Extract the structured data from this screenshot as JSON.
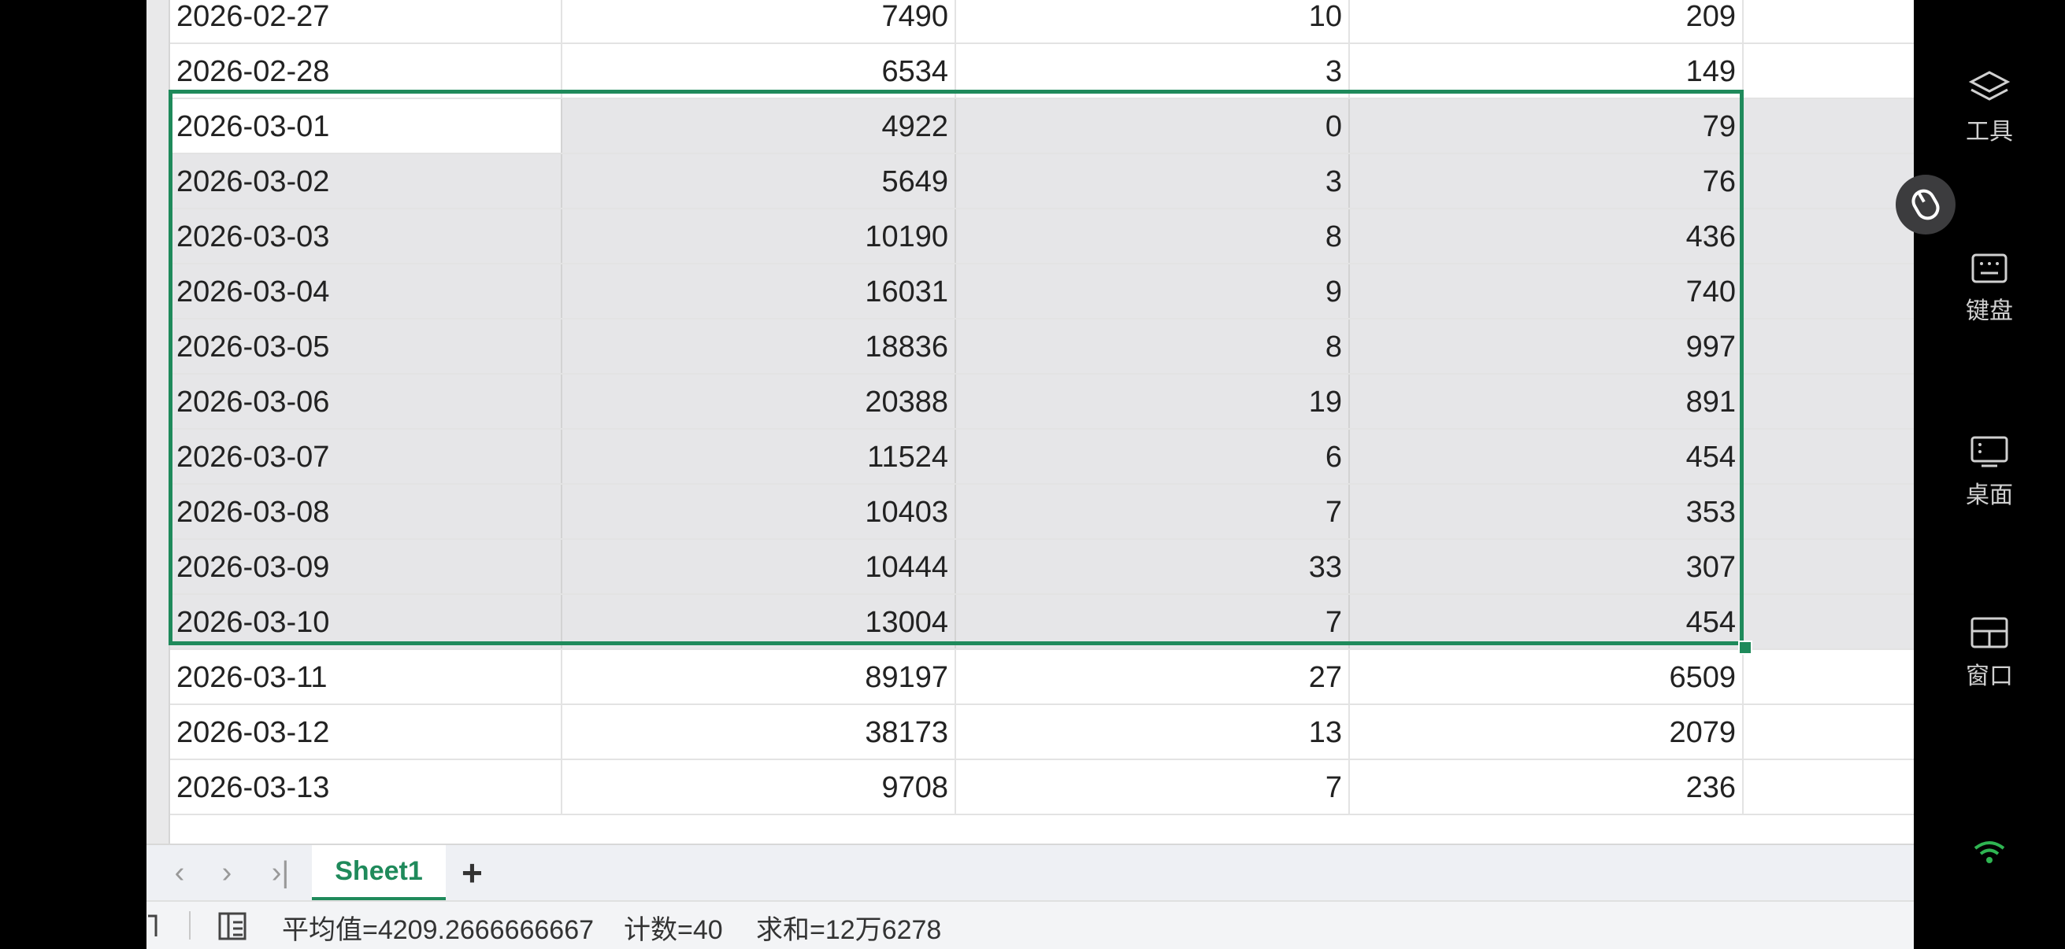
{
  "rows": [
    {
      "date": "2026-02-27",
      "a": "7490",
      "b": "10",
      "c": "209"
    },
    {
      "date": "2026-02-28",
      "a": "6534",
      "b": "3",
      "c": "149"
    },
    {
      "date": "2026-03-01",
      "a": "4922",
      "b": "0",
      "c": "79"
    },
    {
      "date": "2026-03-02",
      "a": "5649",
      "b": "3",
      "c": "76"
    },
    {
      "date": "2026-03-03",
      "a": "10190",
      "b": "8",
      "c": "436"
    },
    {
      "date": "2026-03-04",
      "a": "16031",
      "b": "9",
      "c": "740"
    },
    {
      "date": "2026-03-05",
      "a": "18836",
      "b": "8",
      "c": "997"
    },
    {
      "date": "2026-03-06",
      "a": "20388",
      "b": "19",
      "c": "891"
    },
    {
      "date": "2026-03-07",
      "a": "11524",
      "b": "6",
      "c": "454"
    },
    {
      "date": "2026-03-08",
      "a": "10403",
      "b": "7",
      "c": "353"
    },
    {
      "date": "2026-03-09",
      "a": "10444",
      "b": "33",
      "c": "307"
    },
    {
      "date": "2026-03-10",
      "a": "13004",
      "b": "7",
      "c": "454"
    },
    {
      "date": "2026-03-11",
      "a": "89197",
      "b": "27",
      "c": "6509"
    },
    {
      "date": "2026-03-12",
      "a": "38173",
      "b": "13",
      "c": "2079"
    },
    {
      "date": "2026-03-13",
      "a": "9708",
      "b": "7",
      "c": "236"
    }
  ],
  "tabs": {
    "sheet_name": "Sheet1",
    "add_label": "+",
    "first_icon": "‹",
    "next_icon": "›",
    "last_icon": "›|"
  },
  "status": {
    "average": "平均值=4209.2666666667",
    "count": "计数=40",
    "sum": "求和=12万6278"
  },
  "side_menu": [
    {
      "label": "工具",
      "icon": "layers-icon"
    },
    {
      "label": "键盘",
      "icon": "keyboard-icon"
    },
    {
      "label": "桌面",
      "icon": "desktop-icon"
    },
    {
      "label": "窗口",
      "icon": "window-icon"
    }
  ],
  "colors": {
    "accent": "#1f8a5b",
    "selection_fill": "#e6e6e8",
    "wifi": "#2fb552"
  }
}
